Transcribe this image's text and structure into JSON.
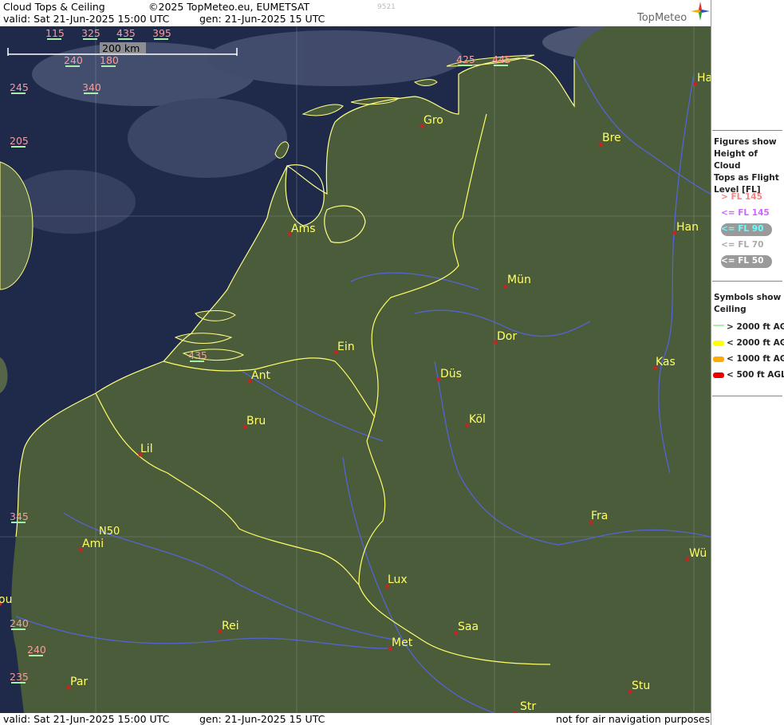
{
  "header": {
    "title": "Cloud Tops & Ceiling",
    "copyright": "©2025 TopMeteo.eu, EUMETSAT",
    "code": "9521",
    "valid": "valid:  Sat  21-Jun-2025  15:00 UTC",
    "gen": "gen:  21-Jun-2025  15 UTC",
    "logo_text": "TopMeteo"
  },
  "footer": {
    "valid": "valid:  Sat  21-Jun-2025  15:00 UTC",
    "gen": "gen:  21-Jun-2025  15 UTC",
    "disclaimer": "not for air navigation purposes"
  },
  "scale_label": "200 km",
  "grid_label": "N50",
  "cities": [
    {
      "id": "ha",
      "name": "Ha"
    },
    {
      "id": "bre",
      "name": "Bre"
    },
    {
      "id": "gro",
      "name": "Gro"
    },
    {
      "id": "ams",
      "name": "Ams"
    },
    {
      "id": "han",
      "name": "Han"
    },
    {
      "id": "mun",
      "name": "Mün"
    },
    {
      "id": "dor",
      "name": "Dor"
    },
    {
      "id": "ein",
      "name": "Ein"
    },
    {
      "id": "ant",
      "name": "Ant"
    },
    {
      "id": "dus",
      "name": "Düs"
    },
    {
      "id": "kas",
      "name": "Kas"
    },
    {
      "id": "bru",
      "name": "Bru"
    },
    {
      "id": "kol",
      "name": "Köl"
    },
    {
      "id": "lil",
      "name": "Lil"
    },
    {
      "id": "fra",
      "name": "Fra"
    },
    {
      "id": "ami",
      "name": "Ami"
    },
    {
      "id": "wu",
      "name": "Wü"
    },
    {
      "id": "lux",
      "name": "Lux"
    },
    {
      "id": "ou",
      "name": "ou"
    },
    {
      "id": "rei",
      "name": "Rei"
    },
    {
      "id": "saa",
      "name": "Saa"
    },
    {
      "id": "met",
      "name": "Met"
    },
    {
      "id": "par",
      "name": "Par"
    },
    {
      "id": "stu",
      "name": "Stu"
    },
    {
      "id": "str",
      "name": "Str"
    }
  ],
  "flight_levels": [
    {
      "id": "fl115",
      "value": "115",
      "color": "#cc88ff"
    },
    {
      "id": "fl325",
      "value": "325",
      "color": "#ff9898"
    },
    {
      "id": "fl435a",
      "value": "435",
      "color": "#ff9898"
    },
    {
      "id": "fl395",
      "value": "395",
      "color": "#ff9898"
    },
    {
      "id": "fl240a",
      "value": "240",
      "color": "#ff9898"
    },
    {
      "id": "fl180",
      "value": "180",
      "color": "#ff9898"
    },
    {
      "id": "fl245",
      "value": "245",
      "color": "#ff9898"
    },
    {
      "id": "fl340",
      "value": "340",
      "color": "#ff9898"
    },
    {
      "id": "fl205",
      "value": "205",
      "color": "#ff9898"
    },
    {
      "id": "fl425",
      "value": "425",
      "color": "#ff9898"
    },
    {
      "id": "fl445",
      "value": "445",
      "color": "#ff9898"
    },
    {
      "id": "fl435b",
      "value": "435",
      "color": "#ff9898"
    },
    {
      "id": "fl345",
      "value": "345",
      "color": "#ff9898"
    },
    {
      "id": "fl240b",
      "value": "240",
      "color": "#ff9898"
    },
    {
      "id": "fl240c",
      "value": "240",
      "color": "#ff9898"
    },
    {
      "id": "fl235",
      "value": "235",
      "color": "#ff9898"
    }
  ],
  "legend": {
    "figures_title": [
      "Figures show",
      "Height of Cloud",
      "Tops as Flight",
      "Level  [FL]"
    ],
    "fl_items": [
      {
        "label": "> FL 145",
        "color": "#ff8080",
        "bg": ""
      },
      {
        "label": "<= FL 145",
        "color": "#cc66ff",
        "bg": ""
      },
      {
        "label": "<= FL 90",
        "color": "#66ffff",
        "bg": "#9a9a9a"
      },
      {
        "label": "<= FL 70",
        "color": "#aaaaaa",
        "bg": ""
      },
      {
        "label": "<= FL 50",
        "color": "#ffffff",
        "bg": "#9a9a9a"
      }
    ],
    "symbols_title": [
      "Symbols show",
      "Ceiling"
    ],
    "ceiling_items": [
      {
        "label": "> 2000 ft AGL",
        "color": "#a8f0a8"
      },
      {
        "label": "< 2000 ft AGL",
        "color": "#ffff00"
      },
      {
        "label": "< 1000 ft AGL",
        "color": "#ffaa00"
      },
      {
        "label": "< 500 ft AGL",
        "color": "#ee0000"
      }
    ]
  },
  "colors": {
    "sea": "#1e2747",
    "land": "#4a5a3a",
    "border": "#ffff88",
    "river": "#5060e0",
    "city_dot": "#cc2222"
  }
}
